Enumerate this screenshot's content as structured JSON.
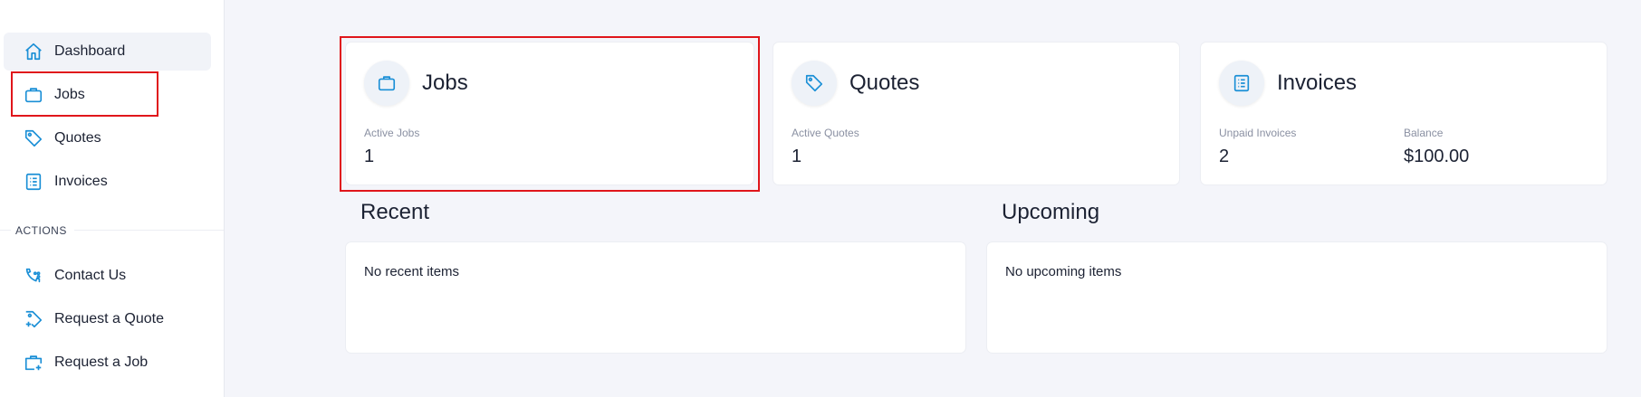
{
  "sidebar": {
    "items": [
      {
        "label": "Dashboard",
        "icon": "home-icon"
      },
      {
        "label": "Jobs",
        "icon": "briefcase-icon"
      },
      {
        "label": "Quotes",
        "icon": "tag-icon"
      },
      {
        "label": "Invoices",
        "icon": "list-icon"
      }
    ],
    "section_label": "ACTIONS",
    "actions": [
      {
        "label": "Contact Us",
        "icon": "contact-icon"
      },
      {
        "label": "Request a Quote",
        "icon": "tag-plus-icon"
      },
      {
        "label": "Request a Job",
        "icon": "briefcase-plus-icon"
      }
    ]
  },
  "cards": {
    "jobs": {
      "title": "Jobs",
      "stat_label": "Active Jobs",
      "stat_value": "1"
    },
    "quotes": {
      "title": "Quotes",
      "stat_label": "Active Quotes",
      "stat_value": "1"
    },
    "invoices": {
      "title": "Invoices",
      "stat_label": "Unpaid Invoices",
      "stat_value": "2",
      "balance_label": "Balance",
      "balance_value": "$100.00"
    }
  },
  "recent": {
    "title": "Recent",
    "empty_text": "No recent items"
  },
  "upcoming": {
    "title": "Upcoming",
    "empty_text": "No upcoming items"
  },
  "colors": {
    "accent": "#1a8fd6",
    "highlight": "#e0161b",
    "background": "#f4f5fa"
  }
}
